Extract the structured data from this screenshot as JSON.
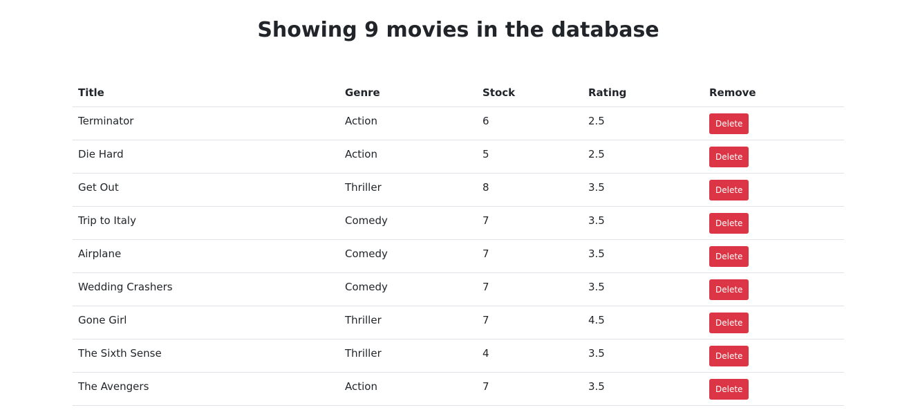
{
  "header": {
    "title": "Showing 9 movies in the database"
  },
  "table": {
    "columns": [
      "Title",
      "Genre",
      "Stock",
      "Rating",
      "Remove"
    ],
    "rows": [
      {
        "title": "Terminator",
        "genre": "Action",
        "stock": "6",
        "rating": "2.5",
        "action": "Delete"
      },
      {
        "title": "Die Hard",
        "genre": "Action",
        "stock": "5",
        "rating": "2.5",
        "action": "Delete"
      },
      {
        "title": "Get Out",
        "genre": "Thriller",
        "stock": "8",
        "rating": "3.5",
        "action": "Delete"
      },
      {
        "title": "Trip to Italy",
        "genre": "Comedy",
        "stock": "7",
        "rating": "3.5",
        "action": "Delete"
      },
      {
        "title": "Airplane",
        "genre": "Comedy",
        "stock": "7",
        "rating": "3.5",
        "action": "Delete"
      },
      {
        "title": "Wedding Crashers",
        "genre": "Comedy",
        "stock": "7",
        "rating": "3.5",
        "action": "Delete"
      },
      {
        "title": "Gone Girl",
        "genre": "Thriller",
        "stock": "7",
        "rating": "4.5",
        "action": "Delete"
      },
      {
        "title": "The Sixth Sense",
        "genre": "Thriller",
        "stock": "4",
        "rating": "3.5",
        "action": "Delete"
      },
      {
        "title": "The Avengers",
        "genre": "Action",
        "stock": "7",
        "rating": "3.5",
        "action": "Delete"
      }
    ]
  },
  "colors": {
    "delete_button": "#dc3545",
    "text": "#212529",
    "row_border": "#dee2e6"
  }
}
